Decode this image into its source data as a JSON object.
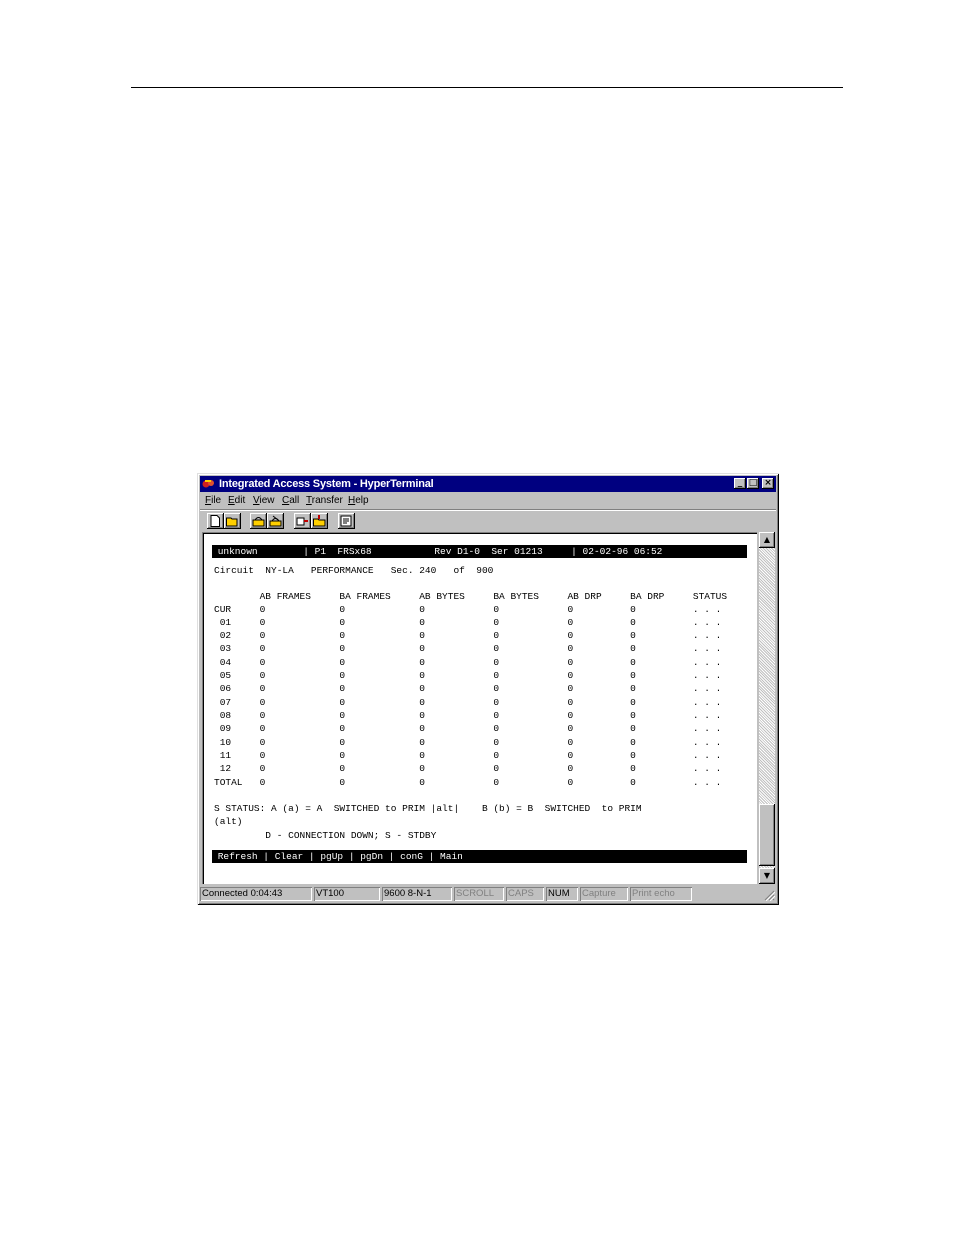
{
  "window": {
    "title": "Integrated Access System - HyperTerminal",
    "buttons": {
      "minimize": "_",
      "maximize": "□",
      "close": "×"
    }
  },
  "menu": [
    {
      "key": "F",
      "rest": "ile"
    },
    {
      "key": "E",
      "rest": "dit"
    },
    {
      "key": "V",
      "rest": "iew"
    },
    {
      "key": "C",
      "rest": "all"
    },
    {
      "key": "T",
      "rest": "ransfer"
    },
    {
      "key": "H",
      "rest": "elp"
    }
  ],
  "toolbar": [
    "new-icon",
    "open-icon",
    "connect-icon",
    "disconnect-icon",
    "send-icon",
    "receive-icon",
    "properties-icon"
  ],
  "terminal": {
    "header_bar": " unknown        | P1  FRSx68           Rev D1-0  Ser 01213     | 02-02-96 06:52",
    "circuit_line": "Circuit  NY-LA   PERFORMANCE   Sec. 240   of  900",
    "column_header": "        AB FRAMES     BA FRAMES     AB BYTES     BA BYTES     AB DRP     BA DRP     STATUS",
    "rows": [
      "CUR     0             0             0            0            0          0          . . .",
      " 01     0             0             0            0            0          0          . . .",
      " 02     0             0             0            0            0          0          . . .",
      " 03     0             0             0            0            0          0          . . .",
      " 04     0             0             0            0            0          0          . . .",
      " 05     0             0             0            0            0          0          . . .",
      " 06     0             0             0            0            0          0          . . .",
      " 07     0             0             0            0            0          0          . . .",
      " 08     0             0             0            0            0          0          . . .",
      " 09     0             0             0            0            0          0          . . .",
      " 10     0             0             0            0            0          0          . . .",
      " 11     0             0             0            0            0          0          . . .",
      " 12     0             0             0            0            0          0          . . .",
      "TOTAL   0             0             0            0            0          0          . . ."
    ],
    "legend_line1": "S STATUS: A (a) = A  SWITCHED to PRIM |alt|    B (b) = B  SWITCHED  to PRIM",
    "legend_line2": "(alt)",
    "legend_line3": "         D - CONNECTION DOWN; S - STDBY",
    "command_bar": " Refresh | Clear | pgUp | pgDn | conG | Main"
  },
  "statusbar": {
    "connected": "Connected 0:04:43",
    "emulation": "VT100",
    "settings": "9600 8-N-1",
    "scroll": "SCROLL",
    "caps": "CAPS",
    "num": "NUM",
    "capture": "Capture",
    "print_echo": "Print echo"
  }
}
